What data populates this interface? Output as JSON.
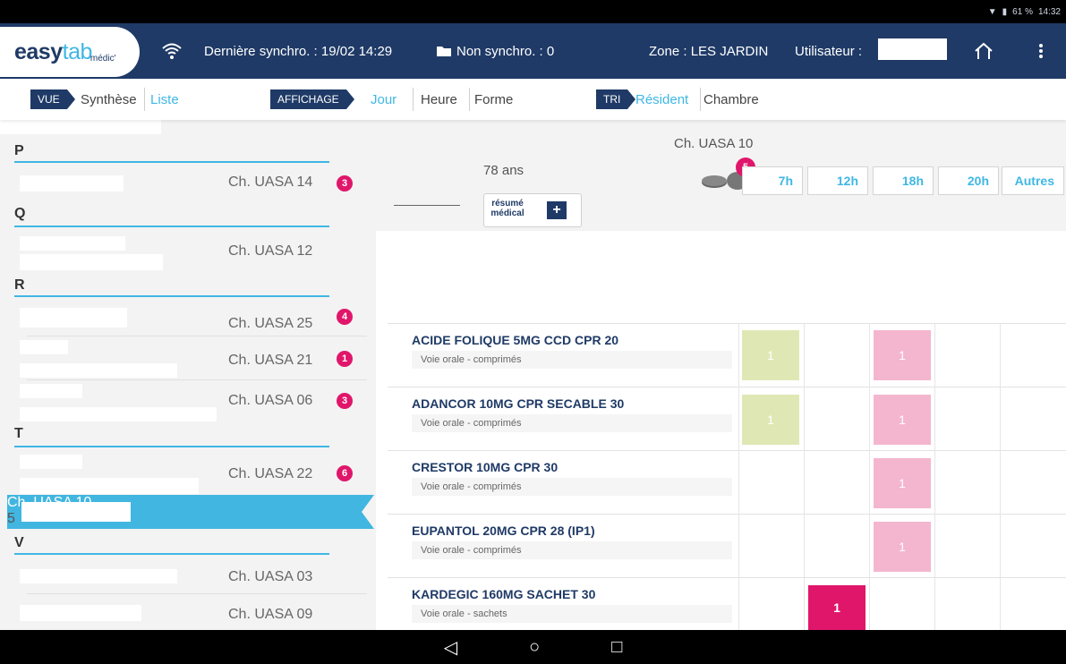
{
  "status": {
    "battery": "61 %",
    "time": "14:32"
  },
  "app": {
    "logo1": "easy",
    "logo2": "tab",
    "logo3": "médic'",
    "sync": "Dernière synchro. : 19/02 14:29",
    "unsync": "Non synchro. : 0",
    "zone": "Zone : LES JARDIN",
    "user_label": "Utilisateur :"
  },
  "toolbar": {
    "vue_tag": "VUE",
    "vue_synthese": "Synthèse",
    "vue_liste": "Liste",
    "aff_tag": "AFFICHAGE",
    "aff_jour": "Jour",
    "aff_heure": "Heure",
    "aff_forme": "Forme",
    "tri_tag": "TRI",
    "tri_resident": "Résident",
    "tri_chambre": "Chambre"
  },
  "sidebar": {
    "letters": [
      "P",
      "Q",
      "R",
      "T",
      "V"
    ],
    "rooms": [
      {
        "room": "Ch. UASA 14",
        "badge": "3"
      },
      {
        "room": "Ch. UASA 12",
        "badge": ""
      },
      {
        "room": "Ch. UASA 25",
        "badge": "4"
      },
      {
        "room": "Ch. UASA 21",
        "badge": "1"
      },
      {
        "room": "Ch. UASA 06",
        "badge": "3"
      },
      {
        "room": "Ch. UASA 22",
        "badge": "6"
      },
      {
        "room": "Ch. UASA 10",
        "badge": "5"
      },
      {
        "room": "Ch. UASA 03",
        "badge": ""
      },
      {
        "room": "Ch. UASA 09",
        "badge": ""
      }
    ]
  },
  "patient": {
    "room": "Ch. UASA 10",
    "age": "78 ans",
    "summary_l1": "résumé",
    "summary_l2": "médical",
    "pill_count": "5"
  },
  "hours": [
    "7h",
    "12h",
    "18h",
    "20h",
    "Autres"
  ],
  "meds": [
    {
      "name": "ACIDE FOLIQUE 5MG CCD CPR 20",
      "route": "Voie orale - comprimés",
      "d7": "1",
      "d18": "1"
    },
    {
      "name": "ADANCOR 10MG CPR SECABLE 30",
      "route": "Voie orale - comprimés",
      "d7": "1",
      "d18": "1"
    },
    {
      "name": "CRESTOR 10MG CPR 30",
      "route": "Voie orale - comprimés",
      "d18": "1"
    },
    {
      "name": "EUPANTOL 20MG CPR 28 (IP1)",
      "route": "Voie orale - comprimés",
      "d18": "1"
    },
    {
      "name": "KARDEGIC 160MG SACHET 30",
      "route": "Voie orale - sachets",
      "d12": "1"
    }
  ],
  "colors": {
    "navy": "#1f3a66",
    "cyan": "#3fb7e4",
    "magenta": "#e0166a",
    "morning": "#dfe8b4",
    "evening": "#f4b6cf"
  },
  "nav": {
    "back": "◁",
    "home": "○",
    "recents": "□"
  }
}
